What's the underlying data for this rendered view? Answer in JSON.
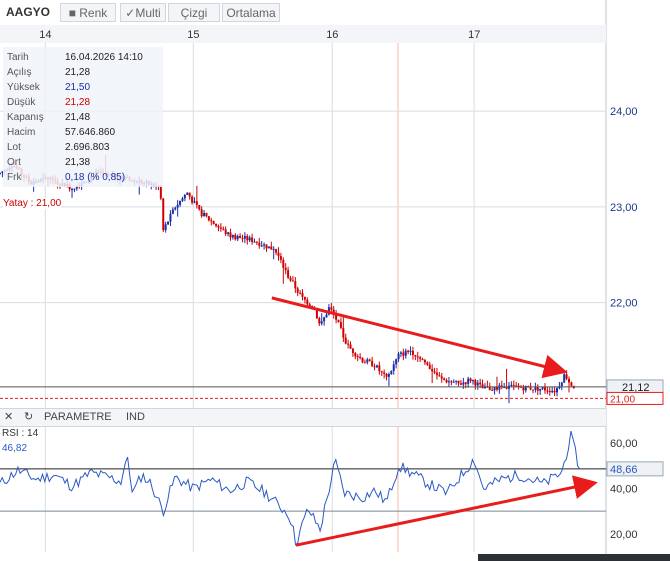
{
  "toolbar": {
    "symbol": "AAGYO",
    "renk": "■ Renk",
    "multi": "✓Multi",
    "cizgi": "Çizgi",
    "ortalama": "Ortalama"
  },
  "info": [
    {
      "key": "Tarih",
      "value": "16.04.2026 14:10",
      "color": "#222222"
    },
    {
      "key": "Açılış",
      "value": "21,28",
      "color": "#222222"
    },
    {
      "key": "Yüksek",
      "value": "21,50",
      "color": "#1a2ea8"
    },
    {
      "key": "Düşük",
      "value": "21,28",
      "color": "#d00000"
    },
    {
      "key": "Kapanış",
      "value": "21,48",
      "color": "#222222"
    },
    {
      "key": "Hacim",
      "value": "57.646.860",
      "color": "#222222"
    },
    {
      "key": "Lot",
      "value": "2.696.803",
      "color": "#222222"
    },
    {
      "key": "Ort",
      "value": "21,38",
      "color": "#222222"
    },
    {
      "key": "Frk",
      "value": "0,18 (% 0,85)",
      "color": "#1a2ea8"
    }
  ],
  "yatay_label": "Yatay : 21,00",
  "panel": {
    "close": "✕",
    "refresh": "↻",
    "parametre": "PARAMETRE",
    "ind": "IND",
    "rsi_label": "RSI : 14",
    "rsi_value": "46,82"
  },
  "chart_data": [
    {
      "type": "candlestick",
      "x_ticks": [
        "14",
        "15",
        "16",
        "17"
      ],
      "ylim": [
        20.9,
        24.9
      ],
      "y_ticks": [
        "24,00",
        "23,00",
        "22,00"
      ],
      "y_tick_values": [
        24.0,
        23.0,
        22.0
      ],
      "last_price": 21.12,
      "last_price_label": "21,12",
      "horizontal_line": 21.0,
      "horizontal_line_label": "21,00",
      "colors": {
        "up": "#1a2ea8",
        "down": "#d00000",
        "trend": "#e81c1c",
        "grid": "#d8dde3"
      },
      "trendline": [
        [
          0.45,
          22.05
        ],
        [
          0.935,
          21.28
        ]
      ],
      "anchors": [
        [
          0.0,
          23.35
        ],
        [
          0.02,
          23.45
        ],
        [
          0.05,
          23.25
        ],
        [
          0.08,
          23.3
        ],
        [
          0.12,
          23.2
        ],
        [
          0.16,
          23.35
        ],
        [
          0.2,
          23.3
        ],
        [
          0.24,
          23.25
        ],
        [
          0.265,
          23.2
        ],
        [
          0.27,
          22.75
        ],
        [
          0.29,
          23.0
        ],
        [
          0.31,
          23.15
        ],
        [
          0.33,
          22.95
        ],
        [
          0.36,
          22.8
        ],
        [
          0.38,
          22.7
        ],
        [
          0.42,
          22.65
        ],
        [
          0.455,
          22.55
        ],
        [
          0.475,
          22.3
        ],
        [
          0.5,
          22.05
        ],
        [
          0.52,
          21.95
        ],
        [
          0.53,
          21.75
        ],
        [
          0.545,
          21.95
        ],
        [
          0.555,
          21.85
        ],
        [
          0.575,
          21.55
        ],
        [
          0.6,
          21.4
        ],
        [
          0.62,
          21.35
        ],
        [
          0.64,
          21.2
        ],
        [
          0.66,
          21.45
        ],
        [
          0.68,
          21.5
        ],
        [
          0.7,
          21.4
        ],
        [
          0.73,
          21.2
        ],
        [
          0.76,
          21.15
        ],
        [
          0.78,
          21.2
        ],
        [
          0.8,
          21.1
        ],
        [
          0.85,
          21.12
        ],
        [
          0.9,
          21.1
        ],
        [
          0.92,
          21.08
        ],
        [
          0.935,
          21.25
        ],
        [
          0.95,
          21.12
        ]
      ]
    },
    {
      "type": "line",
      "name": "RSI",
      "ylim": [
        12,
        68
      ],
      "y_ticks": [
        "60,00",
        "40,00",
        "20,00"
      ],
      "y_tick_values": [
        60,
        40,
        20
      ],
      "levels": [
        48.66,
        30
      ],
      "current_label": "48,66",
      "line_color": "#2b59c3",
      "trendline": [
        [
          0.49,
          15
        ],
        [
          0.985,
          42.5
        ]
      ],
      "anchors": [
        [
          0.0,
          42
        ],
        [
          0.03,
          48
        ],
        [
          0.06,
          44
        ],
        [
          0.09,
          46
        ],
        [
          0.12,
          41
        ],
        [
          0.15,
          47
        ],
        [
          0.18,
          45
        ],
        [
          0.2,
          43
        ],
        [
          0.21,
          54
        ],
        [
          0.22,
          38
        ],
        [
          0.235,
          46
        ],
        [
          0.25,
          42
        ],
        [
          0.27,
          30
        ],
        [
          0.29,
          45
        ],
        [
          0.32,
          40
        ],
        [
          0.35,
          44
        ],
        [
          0.38,
          39
        ],
        [
          0.41,
          43
        ],
        [
          0.44,
          38
        ],
        [
          0.46,
          33
        ],
        [
          0.48,
          28
        ],
        [
          0.49,
          16
        ],
        [
          0.51,
          31
        ],
        [
          0.53,
          22
        ],
        [
          0.545,
          40
        ],
        [
          0.555,
          52
        ],
        [
          0.57,
          38
        ],
        [
          0.6,
          36
        ],
        [
          0.62,
          39
        ],
        [
          0.64,
          34
        ],
        [
          0.66,
          50
        ],
        [
          0.68,
          47
        ],
        [
          0.71,
          42
        ],
        [
          0.74,
          38
        ],
        [
          0.77,
          48
        ],
        [
          0.785,
          53
        ],
        [
          0.8,
          40
        ],
        [
          0.83,
          44
        ],
        [
          0.86,
          46
        ],
        [
          0.9,
          42
        ],
        [
          0.93,
          47
        ],
        [
          0.945,
          63
        ],
        [
          0.96,
          48.66
        ]
      ]
    }
  ]
}
